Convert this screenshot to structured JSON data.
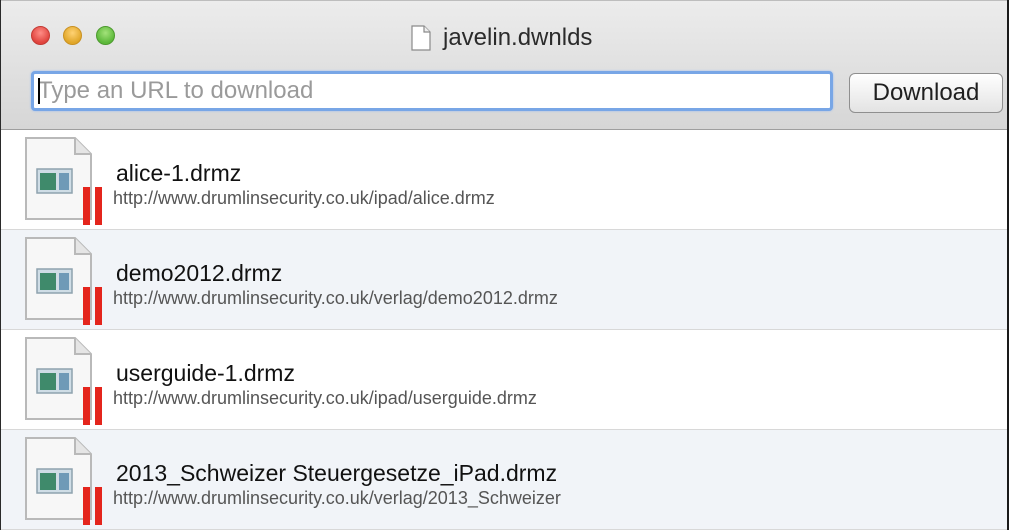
{
  "window": {
    "title": "javelin.dwnlds",
    "colors": {
      "close": "#e0443e",
      "minimize": "#e0a628",
      "zoom": "#5cb83a",
      "focus_ring": "#78a6e6",
      "paused_bars": "#e4251c"
    }
  },
  "toolbar": {
    "url_placeholder": "Type an URL to download",
    "url_value": "",
    "download_label": "Download"
  },
  "downloads": [
    {
      "name": "alice-1.drmz",
      "url": "http://www.drumlinsecurity.co.uk/ipad/alice.drmz",
      "icon": "document-icon",
      "status_icon": "pause-icon"
    },
    {
      "name": "demo2012.drmz",
      "url": "http://www.drumlinsecurity.co.uk/verlag/demo2012.drmz",
      "icon": "document-icon",
      "status_icon": "pause-icon"
    },
    {
      "name": "userguide-1.drmz",
      "url": "http://www.drumlinsecurity.co.uk/ipad/userguide.drmz",
      "icon": "document-icon",
      "status_icon": "pause-icon"
    },
    {
      "name": "2013_Schweizer Steuergesetze_iPad.drmz",
      "url": "http://www.drumlinsecurity.co.uk/verlag/2013_Schweizer",
      "icon": "document-icon",
      "status_icon": "pause-icon"
    }
  ]
}
